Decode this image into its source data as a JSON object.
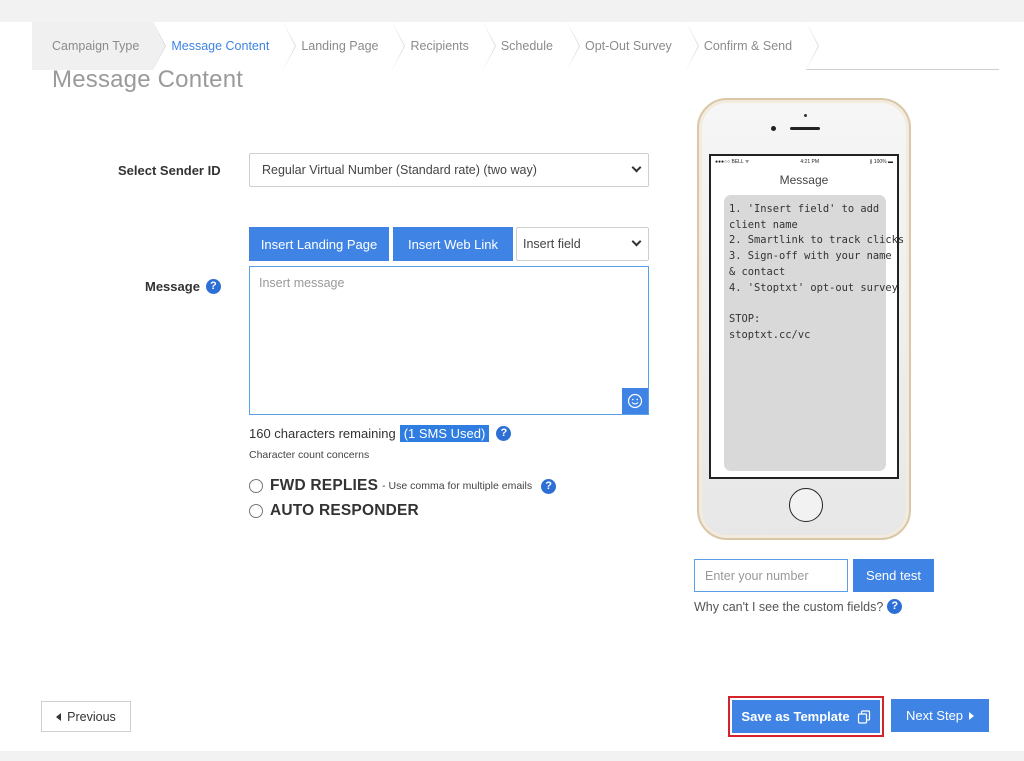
{
  "steps": [
    {
      "label": "Campaign Type"
    },
    {
      "label": "Message Content"
    },
    {
      "label": "Landing Page"
    },
    {
      "label": "Recipients"
    },
    {
      "label": "Schedule"
    },
    {
      "label": "Opt-Out Survey"
    },
    {
      "label": "Confirm & Send"
    }
  ],
  "active_step": "Message Content",
  "page_title": "Message Content",
  "sender": {
    "label": "Select Sender ID",
    "value": "Regular Virtual Number (Standard rate) (two way)"
  },
  "message": {
    "label": "Message",
    "insert_landing_page": "Insert Landing Page",
    "insert_web_link": "Insert Web Link",
    "insert_field": "Insert field",
    "placeholder": "Insert message",
    "chars_remaining": "160 characters remaining",
    "sms_used": "(1 SMS Used)",
    "count_note": "Character count concerns"
  },
  "options": {
    "fwd_label": "FWD REPLIES",
    "fwd_note": "- Use comma for multiple emails",
    "auto_label": "AUTO RESPONDER"
  },
  "phone": {
    "carrier": "●●●○○ BELL ᯤ",
    "time": "4:21 PM",
    "battery": "∦ 100% ▬",
    "screen_title": "Message",
    "preview_lines": [
      "1. 'Insert field' to add",
      "client name",
      "2. Smartlink to track clicks",
      "3. Sign-off with your name",
      "& contact",
      "4. 'Stoptxt' opt-out survey",
      "",
      "STOP:",
      "stoptxt.cc/vc"
    ]
  },
  "test": {
    "placeholder": "Enter your number",
    "send_label": "Send test",
    "custom_fields_question": "Why can't I see the custom fields?"
  },
  "footer": {
    "previous": "Previous",
    "save_template": "Save as Template",
    "next_step": "Next Step"
  },
  "colors": {
    "accent": "#3f84e5",
    "highlight_border": "#d4232b"
  }
}
